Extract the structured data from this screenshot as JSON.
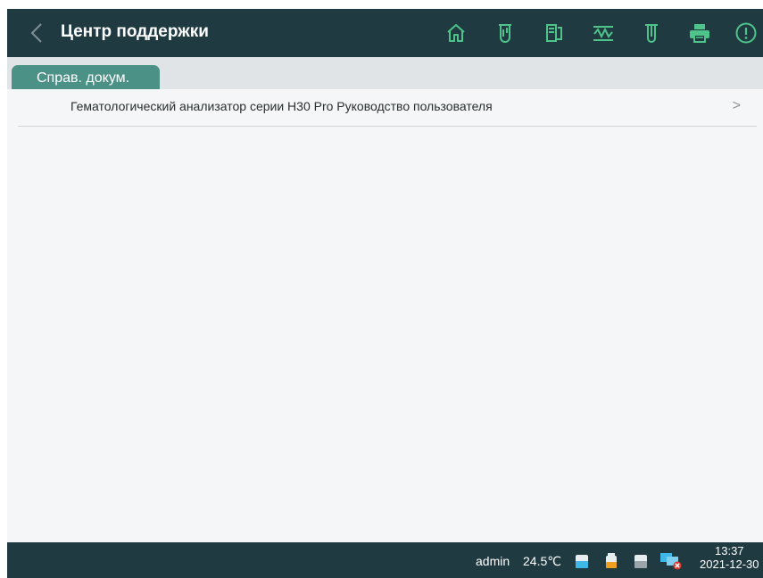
{
  "header": {
    "title": "Центр поддержки",
    "toolbar_icons": [
      "home-icon",
      "test-tube-icon",
      "export-icon",
      "waveform-icon",
      "sample-tube-icon",
      "printer-icon",
      "alert-icon"
    ]
  },
  "tabs": [
    {
      "label": "Справ. докум.",
      "active": true
    }
  ],
  "documents": [
    {
      "label": "Гематологический анализатор серии H30 Pro Руководство пользователя"
    }
  ],
  "status_bar": {
    "user": "admin",
    "temperature": "24.5℃",
    "time": "13:37",
    "date": "2021-12-30",
    "reagent_icons": [
      "reagent-bottle-blue-icon",
      "reagent-bottle-orange-icon",
      "reagent-bottle-gray-icon"
    ],
    "network_icon": "network-disconnected-icon"
  },
  "colors": {
    "header_bg": "#1f3a41",
    "accent_green": "#4c9186",
    "toolbar_icon": "#4fc48a",
    "content_bg": "#e0e4e7",
    "panel_bg": "#f4f6f7",
    "alert_red": "#e03a2f",
    "reagent_blue": "#3fb8e8",
    "reagent_orange": "#f0a020"
  }
}
